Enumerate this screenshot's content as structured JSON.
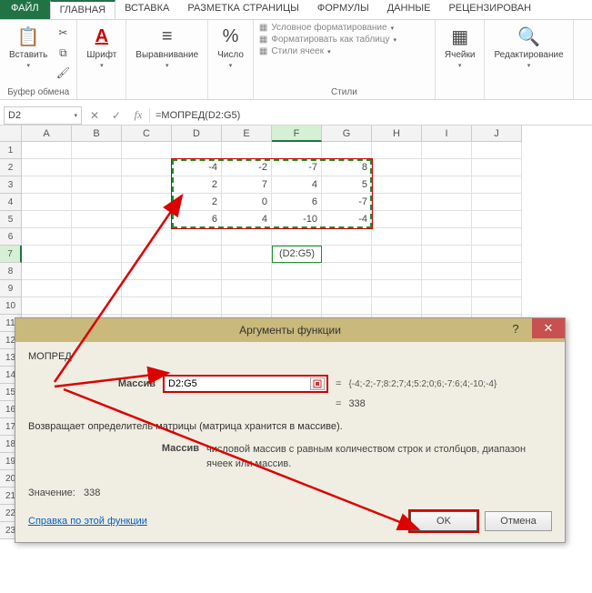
{
  "tabs": {
    "file": "ФАЙЛ",
    "home": "ГЛАВНАЯ",
    "insert": "ВСТАВКА",
    "layout": "РАЗМЕТКА СТРАНИЦЫ",
    "formulas": "ФОРМУЛЫ",
    "data": "ДАННЫЕ",
    "review": "РЕЦЕНЗИРОВАН"
  },
  "ribbon": {
    "clipboard": {
      "paste": "Вставить",
      "label": "Буфер обмена"
    },
    "font": {
      "btn": "Шрифт"
    },
    "align": {
      "btn": "Выравнивание"
    },
    "number": {
      "btn": "Число"
    },
    "styles": {
      "cond": "Условное форматирование",
      "table": "Форматировать как таблицу",
      "cell": "Стили ячеек",
      "label": "Стили"
    },
    "cells": {
      "btn": "Ячейки"
    },
    "editing": {
      "btn": "Редактирование"
    }
  },
  "namebox": "D2",
  "formula": "=МОПРЕД(D2:G5)",
  "cols": [
    "A",
    "B",
    "C",
    "D",
    "E",
    "F",
    "G",
    "H",
    "I",
    "J"
  ],
  "rows": [
    "1",
    "2",
    "3",
    "4",
    "5",
    "6",
    "7",
    "8",
    "9",
    "10",
    "11",
    "12",
    "13",
    "14",
    "15",
    "16",
    "17",
    "18",
    "19",
    "20",
    "21",
    "22",
    "23"
  ],
  "matrix": [
    [
      "-4",
      "-2",
      "-7",
      "8"
    ],
    [
      "2",
      "7",
      "4",
      "5"
    ],
    [
      "2",
      "0",
      "6",
      "-7"
    ],
    [
      "6",
      "4",
      "-10",
      "-4"
    ]
  ],
  "active_cell_text": "(D2:G5)",
  "dialog": {
    "title": "Аргументы функции",
    "fn": "МОПРЕД",
    "arg_label": "Массив",
    "arg_value": "D2:G5",
    "array_preview": "{-4;-2;-7;8:2;7;4;5:2;0;6;-7:6;4;-10;-4}",
    "result": "338",
    "desc": "Возвращает определитель матрицы (матрица хранится в массиве).",
    "arg_desc_label": "Массив",
    "arg_desc_text": "числовой массив с равным количеством строк и столбцов, диапазон ячеек или массив.",
    "value_label": "Значение:",
    "value": "338",
    "help": "Справка по этой функции",
    "ok": "OK",
    "cancel": "Отмена"
  },
  "chart_data": {
    "type": "table",
    "title": "МОПРЕД matrix input D2:G5",
    "columns": [
      "D",
      "E",
      "F",
      "G"
    ],
    "rows": [
      "2",
      "3",
      "4",
      "5"
    ],
    "values": [
      [
        -4,
        -2,
        -7,
        8
      ],
      [
        2,
        7,
        4,
        5
      ],
      [
        2,
        0,
        6,
        -7
      ],
      [
        6,
        4,
        -10,
        -4
      ]
    ],
    "determinant": 338
  }
}
